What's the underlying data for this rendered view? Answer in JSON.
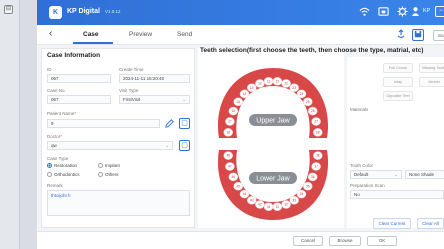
{
  "side": {
    "button_glyph": "⊟"
  },
  "titlebar": {
    "app_name": "KP Digital",
    "version": "V1.0.12",
    "user": "KP",
    "wifi_icon": "wifi-icon",
    "window_icon": "window-icon",
    "settings_icon": "gear-icon",
    "user_icon": "user-icon",
    "box_glyph": "−"
  },
  "nav": {
    "back_glyph": "‹",
    "tabs": [
      {
        "label": "Case"
      },
      {
        "label": "Preview"
      },
      {
        "label": "Send"
      }
    ],
    "scan_button_label": "Scan"
  },
  "case_info": {
    "title": "Case Information",
    "id_label": "ID",
    "id_value": "067",
    "create_time_label": "Create Time",
    "create_time_value": "2024-11-11 15:20:40",
    "case_no_label": "Case No.",
    "case_no_value": "067",
    "visit_type_label": "Visit Type",
    "visit_type_value": "FirstVisit",
    "patient_name_label": "Patient Name*",
    "patient_name_value": "9",
    "doctor_label": "Doctor*",
    "doctor_value": "qw",
    "case_type_label": "Case Type",
    "case_types": [
      {
        "label": "Restoration",
        "checked": true
      },
      {
        "label": "Implant",
        "checked": false
      },
      {
        "label": "Orthodontics",
        "checked": false
      },
      {
        "label": "Others",
        "checked": false
      }
    ],
    "remark_label": "Remark",
    "remark_value": "thtoijoht h"
  },
  "teeth": {
    "title": "Teeth selection(first choose the teeth, then choose the type, matrial, etc)",
    "upper_label": "Upper Jaw",
    "lower_label": "Lower Jaw",
    "upper_numbers": [
      "18",
      "17",
      "16",
      "15",
      "14",
      "13",
      "12",
      "11",
      "21",
      "22",
      "23",
      "24",
      "25",
      "26",
      "27",
      "28"
    ],
    "lower_numbers": [
      "48",
      "47",
      "46",
      "45",
      "44",
      "43",
      "42",
      "41",
      "31",
      "32",
      "33",
      "34",
      "35",
      "36",
      "37",
      "38"
    ],
    "tooth_color": "#ffffff",
    "gum_color": "#d94848"
  },
  "right_panel": {
    "type_chips": [
      "Full Crown",
      "Missing Tooth",
      "Inlay",
      "Veneer",
      "Opposite Teet"
    ],
    "materials_label": "Materials",
    "tooth_color_label": "Tooth Color",
    "tooth_color_value": "Default",
    "shade_value": "None Shade",
    "preparation_scan_label": "Preparation Scan",
    "preparation_scan_value": "No",
    "clear_current_label": "Clear Current",
    "clear_all_label": "Clear All"
  },
  "footer": {
    "cancel_label": "Cancel",
    "browse_label": "Browse",
    "ok_label": "OK"
  },
  "colors": {
    "accent": "#2f6fd6",
    "titlebar": "#3a84e9",
    "gum": "#d94848"
  }
}
